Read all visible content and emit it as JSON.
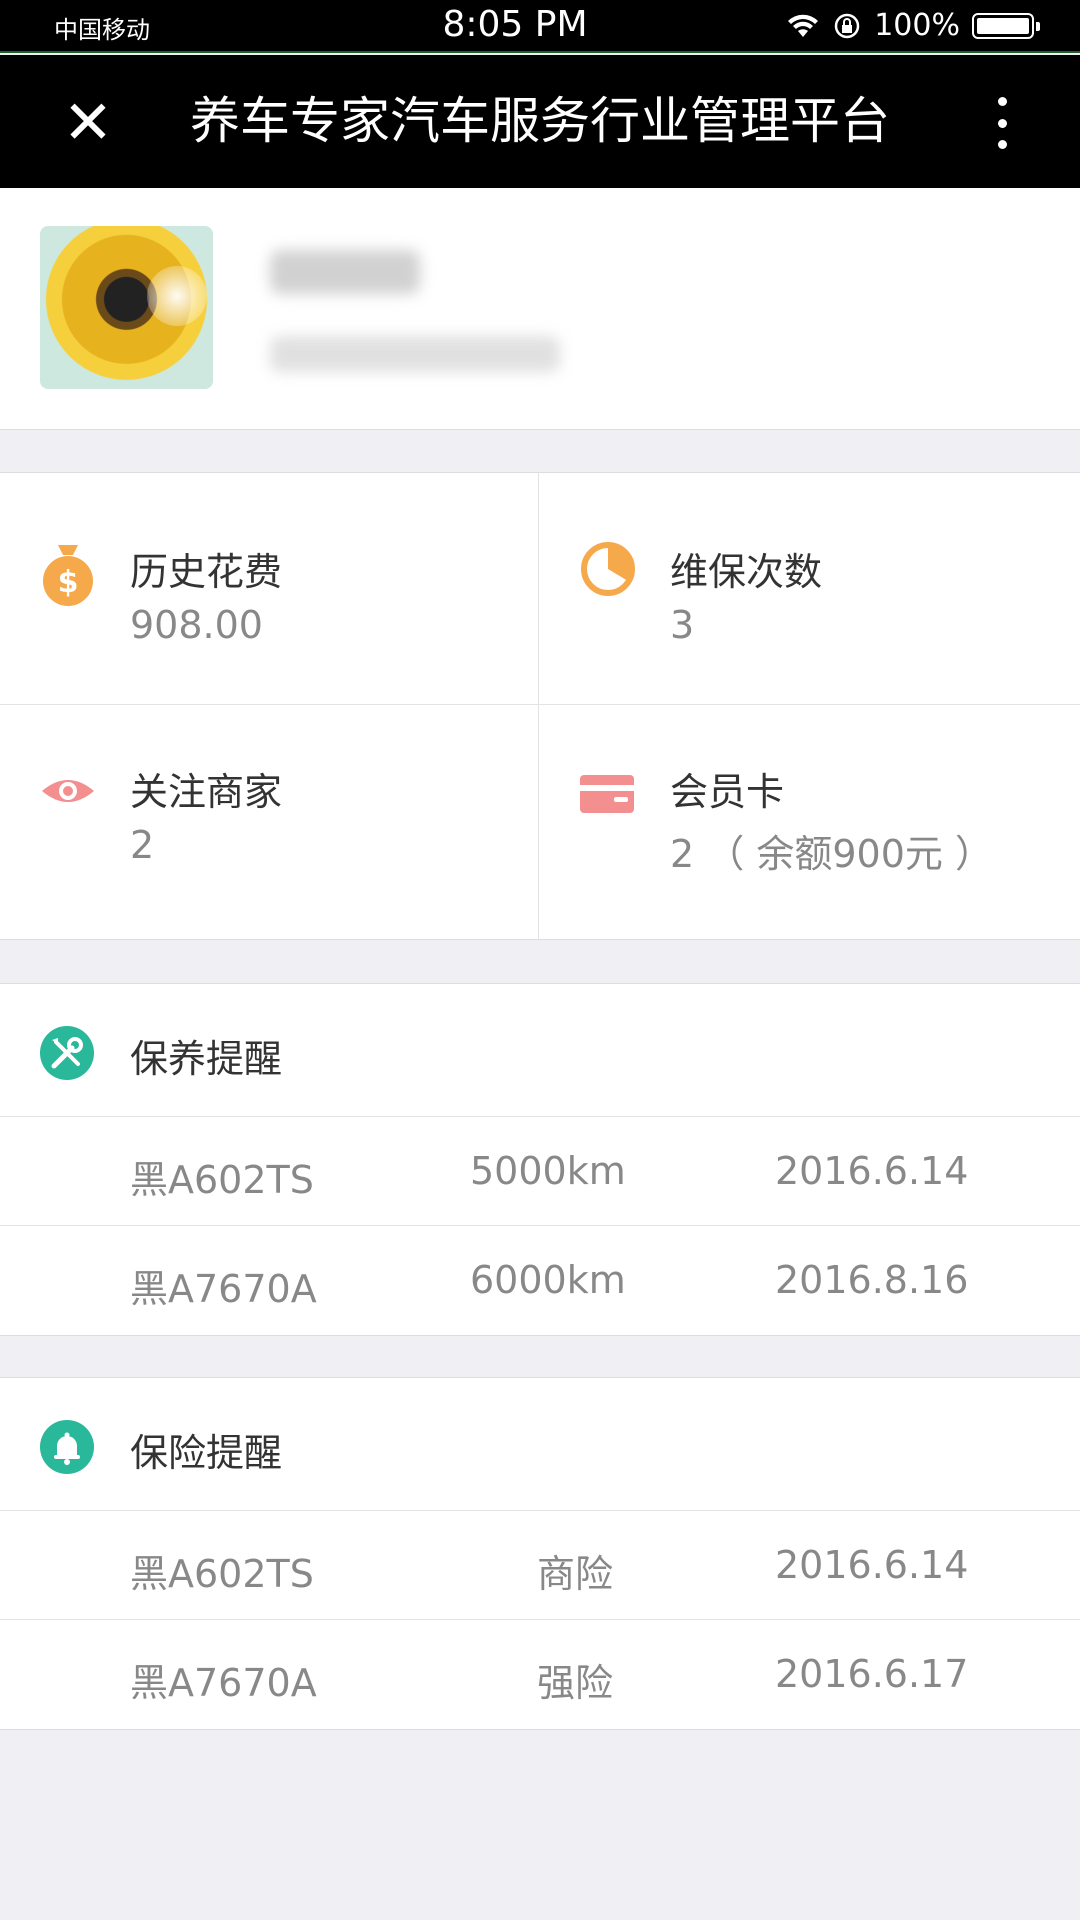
{
  "status_bar": {
    "carrier": "中国移动",
    "time": "8:05 PM",
    "battery_percent": "100%"
  },
  "nav": {
    "title": "养车专家汽车服务行业管理平台"
  },
  "stats": [
    {
      "label": "历史花费",
      "value": "908.00",
      "icon": "money-bag-icon",
      "color": "#f5a94a"
    },
    {
      "label": "维保次数",
      "value": "3",
      "icon": "pie-clock-icon",
      "color": "#f5a94a"
    },
    {
      "label": "关注商家",
      "value": "2",
      "icon": "eye-icon",
      "color": "#f38f8f"
    },
    {
      "label": "会员卡",
      "value": "2 （ 余额900元 ）",
      "icon": "card-icon",
      "color": "#f38f8f"
    }
  ],
  "maintenance": {
    "title": "保养提醒",
    "icon": "wrench-screwdriver-icon",
    "color": "#2ab89a",
    "rows": [
      {
        "plate": "黑A602TS",
        "detail": "5000km",
        "date": "2016.6.14"
      },
      {
        "plate": "黑A7670A",
        "detail": "6000km",
        "date": "2016.8.16"
      }
    ]
  },
  "insurance": {
    "title": "保险提醒",
    "icon": "bell-icon",
    "color": "#2ab89a",
    "rows": [
      {
        "plate": "黑A602TS",
        "detail": "商险",
        "date": "2016.6.14"
      },
      {
        "plate": "黑A7670A",
        "detail": "强险",
        "date": "2016.6.17"
      }
    ]
  }
}
